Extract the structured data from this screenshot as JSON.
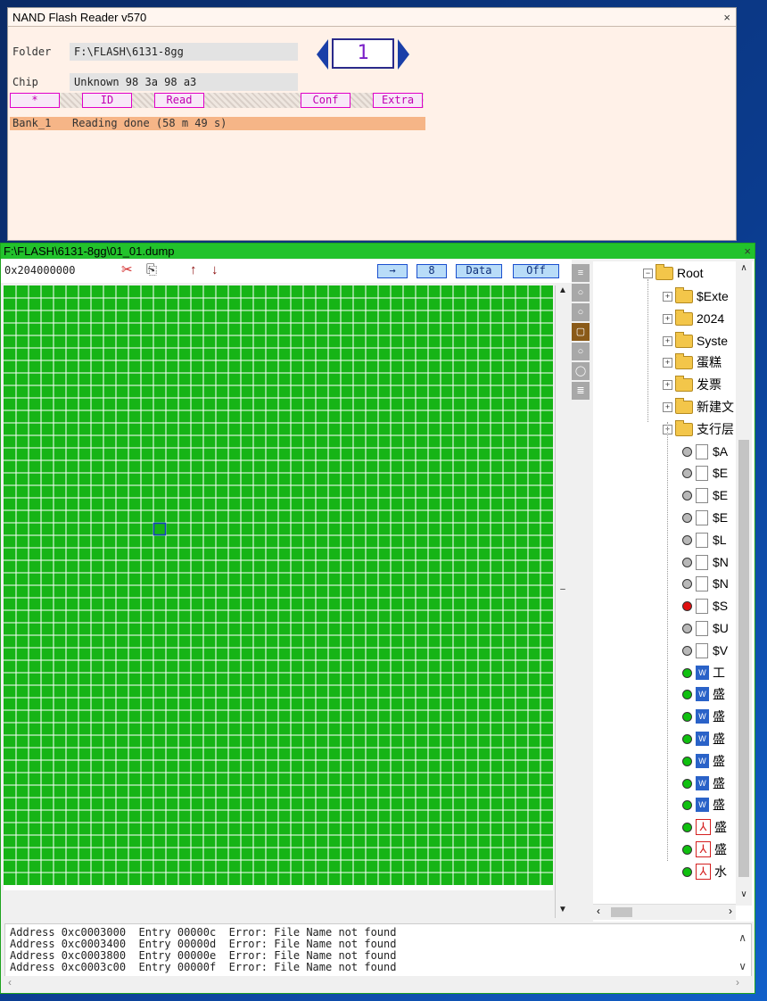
{
  "reader": {
    "title": "NAND Flash Reader v570",
    "close": "×",
    "folder_label": "Folder",
    "folder_value": "F:\\FLASH\\6131-8gg",
    "chip_label": "Chip",
    "chip_value": "Unknown  98 3a 98 a3",
    "page_number": "1",
    "buttons": [
      "*",
      "ID",
      "Read",
      "Conf",
      "Extra"
    ],
    "status_bank": "Bank_1",
    "status_text": "Reading done (58 m 49 s)"
  },
  "dump": {
    "title": "F:\\FLASH\\6131-8gg\\01_01.dump",
    "close": "×",
    "address": "0x204000000",
    "toolbar_buttons": [
      "→",
      "8",
      "Data",
      "Off"
    ],
    "grid": {
      "block_color": "#16b416",
      "marker_color": "#1a3fc8"
    }
  },
  "tree": {
    "root": "Root",
    "folders": [
      "$Exte",
      "2024",
      "Syste",
      "蛋糕",
      "发票",
      "新建文",
      "支行层"
    ],
    "files": [
      {
        "name": "$A",
        "status": "gray",
        "icon": "file"
      },
      {
        "name": "$E",
        "status": "gray",
        "icon": "file"
      },
      {
        "name": "$E",
        "status": "gray",
        "icon": "file"
      },
      {
        "name": "$E",
        "status": "gray",
        "icon": "file"
      },
      {
        "name": "$L",
        "status": "gray",
        "icon": "file"
      },
      {
        "name": "$N",
        "status": "gray",
        "icon": "file"
      },
      {
        "name": "$N",
        "status": "gray",
        "icon": "file"
      },
      {
        "name": "$S",
        "status": "red",
        "icon": "file"
      },
      {
        "name": "$U",
        "status": "gray",
        "icon": "file"
      },
      {
        "name": "$V",
        "status": "gray",
        "icon": "file"
      },
      {
        "name": "工",
        "status": "green",
        "icon": "doc"
      },
      {
        "name": "盛",
        "status": "green",
        "icon": "doc"
      },
      {
        "name": "盛",
        "status": "green",
        "icon": "doc"
      },
      {
        "name": "盛",
        "status": "green",
        "icon": "doc"
      },
      {
        "name": "盛",
        "status": "green",
        "icon": "doc"
      },
      {
        "name": "盛",
        "status": "green",
        "icon": "doc"
      },
      {
        "name": "盛",
        "status": "green",
        "icon": "doc"
      },
      {
        "name": "盛",
        "status": "green",
        "icon": "pdf"
      },
      {
        "name": "盛",
        "status": "green",
        "icon": "pdf"
      },
      {
        "name": "水",
        "status": "green",
        "icon": "pdf"
      }
    ],
    "status_colors": {
      "gray": "#b8b8b8",
      "red": "#e01010",
      "green": "#10c010"
    }
  },
  "log": [
    "Address 0xc0003000  Entry 00000c  Error: File Name not found",
    "Address 0xc0003400  Entry 00000d  Error: File Name not found",
    "Address 0xc0003800  Entry 00000e  Error: File Name not found",
    "Address 0xc0003c00  Entry 00000f  Error: File Name not found"
  ]
}
